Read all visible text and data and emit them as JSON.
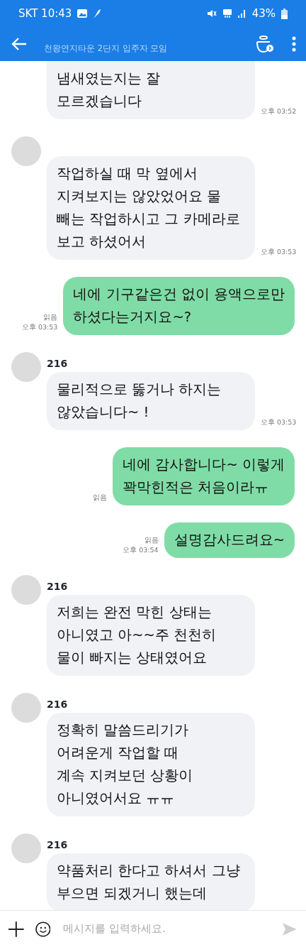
{
  "status_bar": {
    "carrier_time": "SKT 10:43",
    "battery": "43%"
  },
  "header": {
    "subtitle": "천왕연지타운 2단지 입주자 모임"
  },
  "messages": [
    {
      "kind": "incoming",
      "show_avatar": false,
      "text": "냄새였는지는 잘\n모르겠습니다",
      "time": "오후 03:52"
    },
    {
      "kind": "incoming",
      "show_avatar": true,
      "text": "작업하실 때 막 옆에서\n지켜보지는 않았었어요 물\n빼는 작업하시고 그 카메라로\n보고 하셨어서",
      "time": "오후 03:53"
    },
    {
      "kind": "outgoing",
      "text": "네에 기구같은건 없이 용액으로만\n하셨다는거지요~?",
      "read": "읽음",
      "time": "오후 03:53"
    },
    {
      "kind": "incoming",
      "show_avatar": true,
      "sender": "216",
      "text": "물리적으로 뚫거나 하지는\n않았습니다~ !",
      "time": "오후 03:53"
    },
    {
      "kind": "outgoing",
      "text": "네에 감사합니다~ 이렇게\n꽉막힌적은 처음이라ㅠ",
      "read": "읽음"
    },
    {
      "kind": "outgoing",
      "text": "설명감사드려요~",
      "read": "읽음",
      "time": "오후 03:54"
    },
    {
      "kind": "incoming",
      "show_avatar": true,
      "sender": "216",
      "text": "저희는 완전 막힌 상태는\n아니였고 아~~주 천천히\n물이 빠지는 상태였어요"
    },
    {
      "kind": "incoming",
      "show_avatar": true,
      "sender": "216",
      "text": "정확히 말씀드리기가\n어려운게 작업할 때\n계속 지켜보던 상황이\n아니였어서요 ㅠㅠ"
    },
    {
      "kind": "incoming",
      "show_avatar": true,
      "sender": "216",
      "text": "약품처리 한다고 하셔서 그냥\n부으면 되겠거니 했는데"
    }
  ],
  "composer": {
    "placeholder": "메시지를 입력하세요."
  }
}
